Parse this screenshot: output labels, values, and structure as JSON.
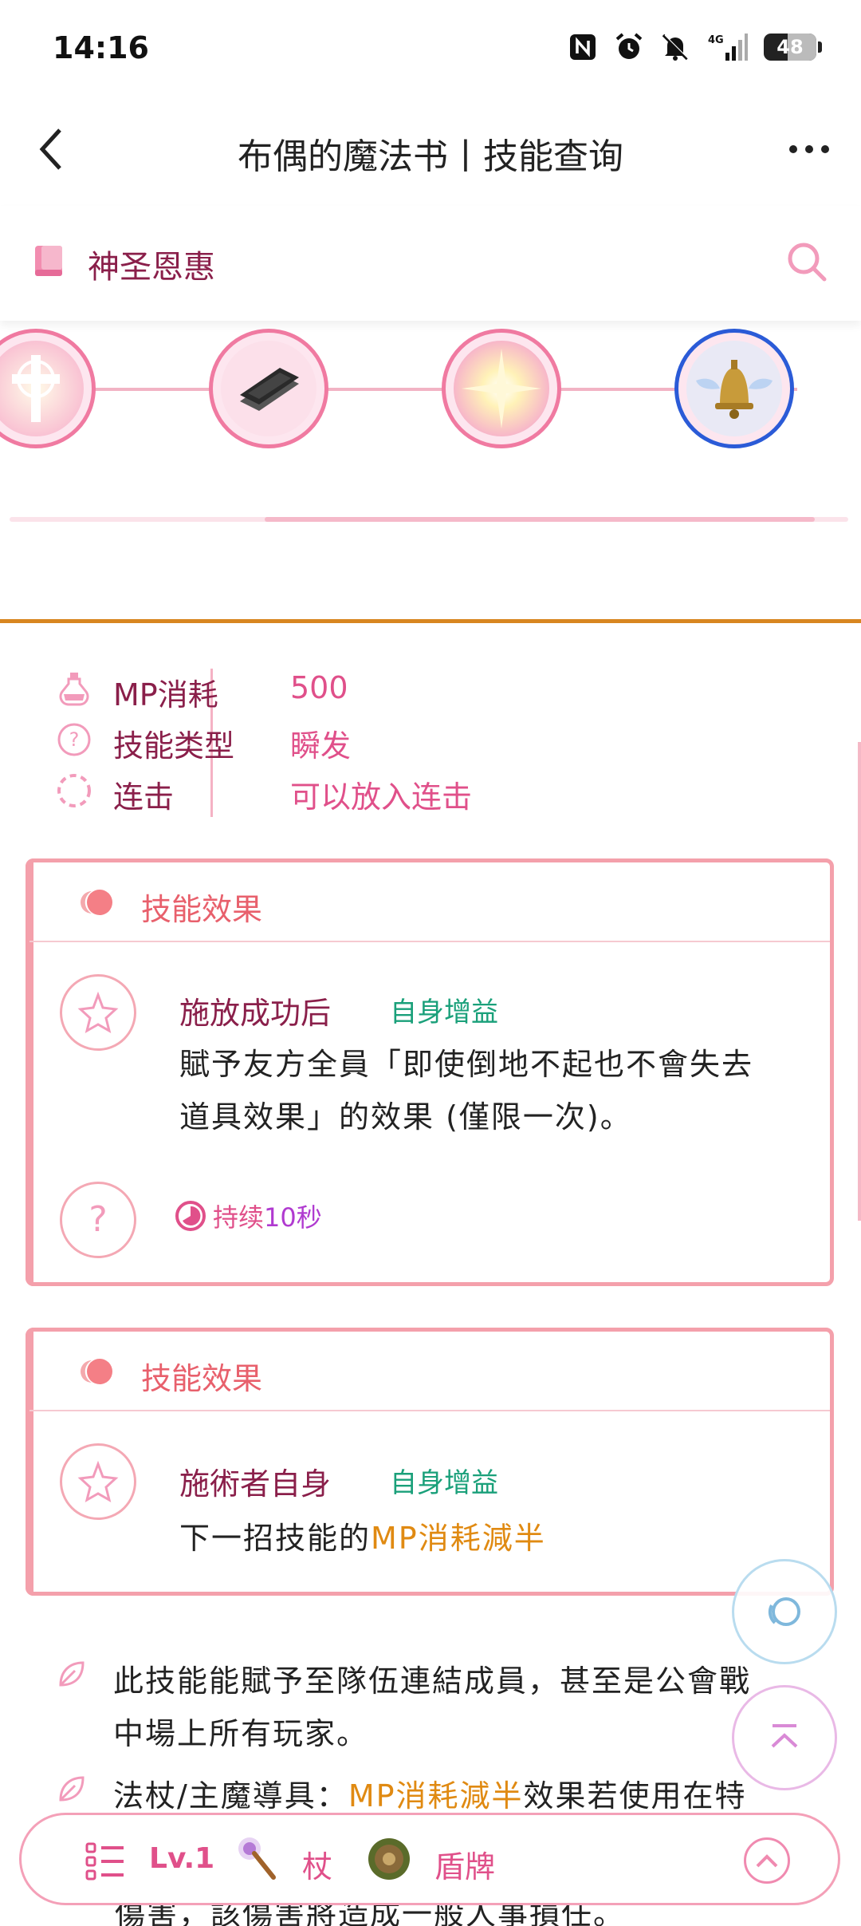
{
  "status_bar": {
    "time": "14:16",
    "battery": "48",
    "icons": [
      "nfc-icon",
      "alarm-icon",
      "mute-icon",
      "signal-4g-icon",
      "battery-icon"
    ]
  },
  "header": {
    "title": "布偶的魔法书丨技能查询",
    "back_icon": "chevron-left-icon",
    "more_icon": "more-horizontal-icon"
  },
  "category": {
    "label": "神圣恩惠",
    "icon": "book-icon",
    "search_icon": "search-icon"
  },
  "skill_chain": {
    "nodes": [
      "holy-cross-skill-icon",
      "dark-book-skill-icon",
      "radiant-light-skill-icon",
      "winged-bell-skill-icon"
    ],
    "active_index": 3
  },
  "info": {
    "rows": [
      {
        "icon": "potion-icon",
        "label": "MP消耗",
        "value": "500"
      },
      {
        "icon": "question-circle-icon",
        "label": "技能类型",
        "value": "瞬发"
      },
      {
        "icon": "combo-dashed-circle-icon",
        "label": "连击",
        "value": "可以放入连击"
      }
    ]
  },
  "effects": [
    {
      "title": "技能效果",
      "when": "施放成功后",
      "tag": "自身增益",
      "desc_line1": "賦予友方全員「即使倒地不起也不會失去",
      "desc_line2": "道具效果」的效果 (僅限一次)。",
      "duration_prefix": "持续",
      "duration_value": "10秒"
    },
    {
      "title": "技能效果",
      "when": "施術者自身",
      "tag": "自身增益",
      "desc_plain": "下一招技能的",
      "desc_highlight": "MP消耗減半"
    }
  ],
  "notes": [
    {
      "line1": "此技能能賦予至隊伍連結成員，甚至是公會戰",
      "line2": "中場上所有玩家。"
    },
    {
      "prefix": "法杖/主魔導具：",
      "highlight": "MP消耗減半",
      "suffix": "效果若使用在特"
    }
  ],
  "cut_line": "傷害，該傷害將造成一般人事損任。",
  "bottom_bar": {
    "level": "Lv.1",
    "weapon": "杖",
    "offhand": "盾牌"
  },
  "colors": {
    "accent_pink": "#e0508a",
    "label_maroon": "#8a1f4a",
    "tag_green": "#1aa07a",
    "highlight_orange": "#e08a12",
    "divider_orange": "#d88620"
  }
}
